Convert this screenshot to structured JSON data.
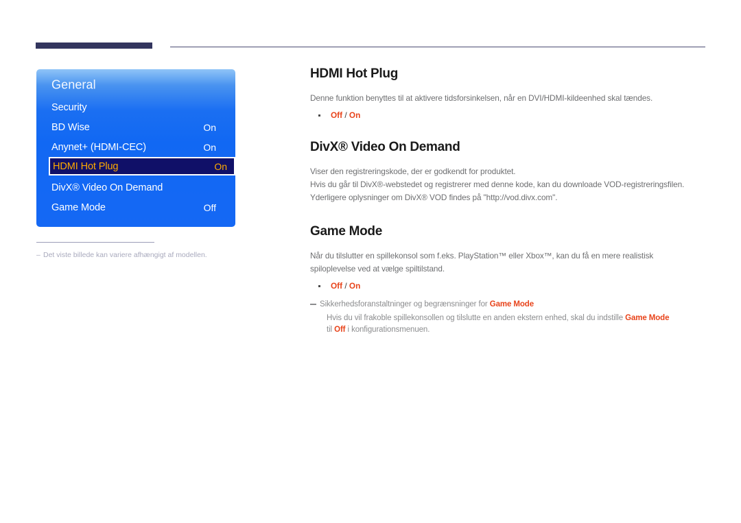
{
  "header": {
    "rule_color": "#33355e",
    "thin_rule_color": "#4a4b72"
  },
  "osd_menu": {
    "title": "General",
    "highlighted_item": "HDMI Hot Plug",
    "highlight_text_color": "#ffaa00",
    "highlight_background": "#101068",
    "menu_background": "#1568f4",
    "items": [
      {
        "label": "Security",
        "value": ""
      },
      {
        "label": "BD Wise",
        "value": "On"
      },
      {
        "label": "Anynet+ (HDMI-CEC)",
        "value": "On"
      },
      {
        "label": "HDMI Hot Plug",
        "value": "On"
      },
      {
        "label": "DivX® Video On Demand",
        "value": ""
      },
      {
        "label": "Game Mode",
        "value": "Off"
      }
    ],
    "footnote_dash": "–",
    "footnote": "Det viste billede kan variere afhængigt af modellen."
  },
  "article": {
    "sections": [
      {
        "heading": "HDMI Hot Plug",
        "paragraphs": [
          "Denne funktion benyttes til at aktivere tidsforsinkelsen, når en DVI/HDMI-kildeenhed skal tændes."
        ],
        "option_bullet": {
          "first": "Off",
          "separator": " / ",
          "second": "On"
        }
      },
      {
        "heading": "DivX® Video On Demand",
        "paragraphs": [
          "Viser den registreringskode, der er godkendt for produktet.",
          "Hvis du går til DivX®-webstedet og registrerer med denne kode, kan du downloade VOD-registreringsfilen.",
          "Yderligere oplysninger om DivX® VOD findes på \"http://vod.divx.com\"."
        ]
      },
      {
        "heading": "Game Mode",
        "paragraphs": [
          "Når du tilslutter en spillekonsol som f.eks. PlayStation™ eller Xbox™, kan du få en mere realistisk spiloplevelse ved at vælge spiltilstand."
        ],
        "option_bullet": {
          "first": "Off",
          "separator": " / ",
          "second": "On"
        },
        "note": {
          "title_prefix": "Sikkerhedsforanstaltninger og begrænsninger for ",
          "title_emphasis": "Game Mode",
          "body_part1": "Hvis du vil frakoble spillekonsollen og tilslutte en anden ekstern enhed, skal du indstille ",
          "body_em1": "Game Mode",
          "body_part2": " til ",
          "body_em2": "Off",
          "body_part3": " i konfigurationsmenuen."
        }
      }
    ],
    "accent_color": "#e8441b",
    "body_color": "#6d6e70"
  }
}
